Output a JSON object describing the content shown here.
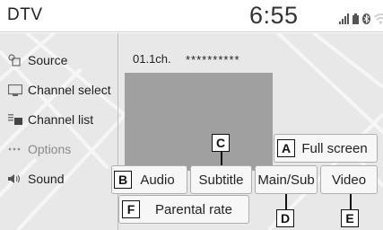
{
  "header": {
    "title": "DTV",
    "clock": "6:55",
    "status_icons": [
      "signal-icon",
      "battery-icon",
      "bluetooth-icon",
      "wifi-icon"
    ]
  },
  "sidebar": {
    "items": [
      {
        "label": "Source",
        "icon": "source-icon"
      },
      {
        "label": "Channel select",
        "icon": "monitor-icon"
      },
      {
        "label": "Channel list",
        "icon": "list-icon"
      },
      {
        "label": "Options",
        "icon": "more-icon"
      },
      {
        "label": "Sound",
        "icon": "speaker-icon"
      }
    ]
  },
  "main": {
    "channel": "01.1ch.",
    "program_name": "**********",
    "buttons": {
      "full_screen": "Full screen",
      "audio": "Audio",
      "subtitle": "Subtitle",
      "main_sub": "Main/Sub",
      "video": "Video",
      "parental_rate": "Parental rate"
    }
  },
  "callouts": {
    "a": "A",
    "b": "B",
    "c": "C",
    "d": "D",
    "e": "E",
    "f": "F"
  },
  "colors": {
    "video_placeholder": "#a0a0a0",
    "background": "#e8e8e8",
    "button": "#f7f7f7"
  }
}
